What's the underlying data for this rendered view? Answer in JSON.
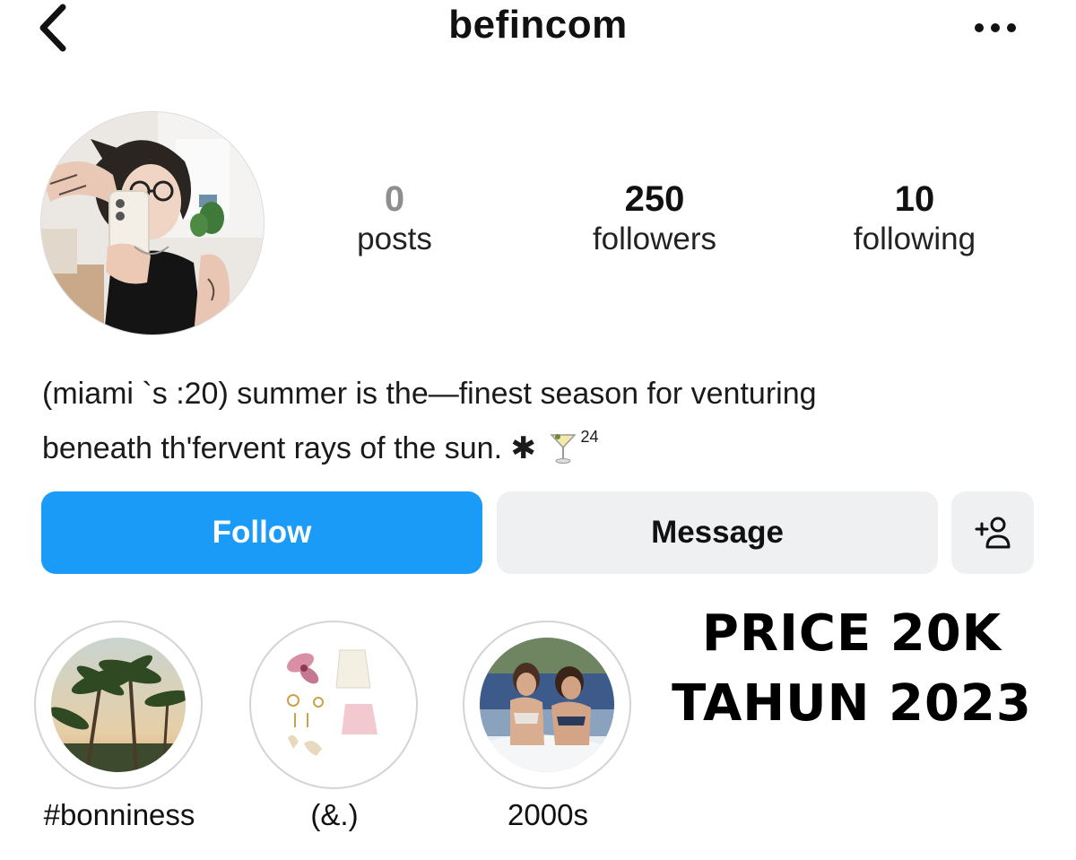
{
  "header": {
    "username": "befincom",
    "back_icon": "chevron-left-icon",
    "more_icon": "more-horizontal-icon"
  },
  "profile": {
    "avatar": "profile-photo",
    "stats": [
      {
        "value": "0",
        "label": "posts"
      },
      {
        "value": "250",
        "label": "followers"
      },
      {
        "value": "10",
        "label": "following"
      }
    ],
    "bio": {
      "line1": "(miami `s :20) summer is the—finest season for venturing",
      "line2_text": "beneath th'fervent rays of the sun. ",
      "line2_glyph": "✱",
      "line2_emoji": "cocktail-glass-icon",
      "line2_sup": "24"
    }
  },
  "actions": {
    "follow_label": "Follow",
    "message_label": "Message",
    "add_user_icon": "add-user-icon"
  },
  "promo": {
    "line1": "PRICE 20K",
    "line2": "TAHUN 2023"
  },
  "highlights": [
    {
      "label": "#bonniness",
      "thumb": "palm-trees"
    },
    {
      "label": "(&.)",
      "thumb": "outfit-collage"
    },
    {
      "label": "2000s",
      "thumb": "friends-on-boat"
    }
  ],
  "colors": {
    "follow_blue": "#1a9bf8",
    "secondary_button": "#eff0f2",
    "muted_number": "#8e8e8e"
  }
}
